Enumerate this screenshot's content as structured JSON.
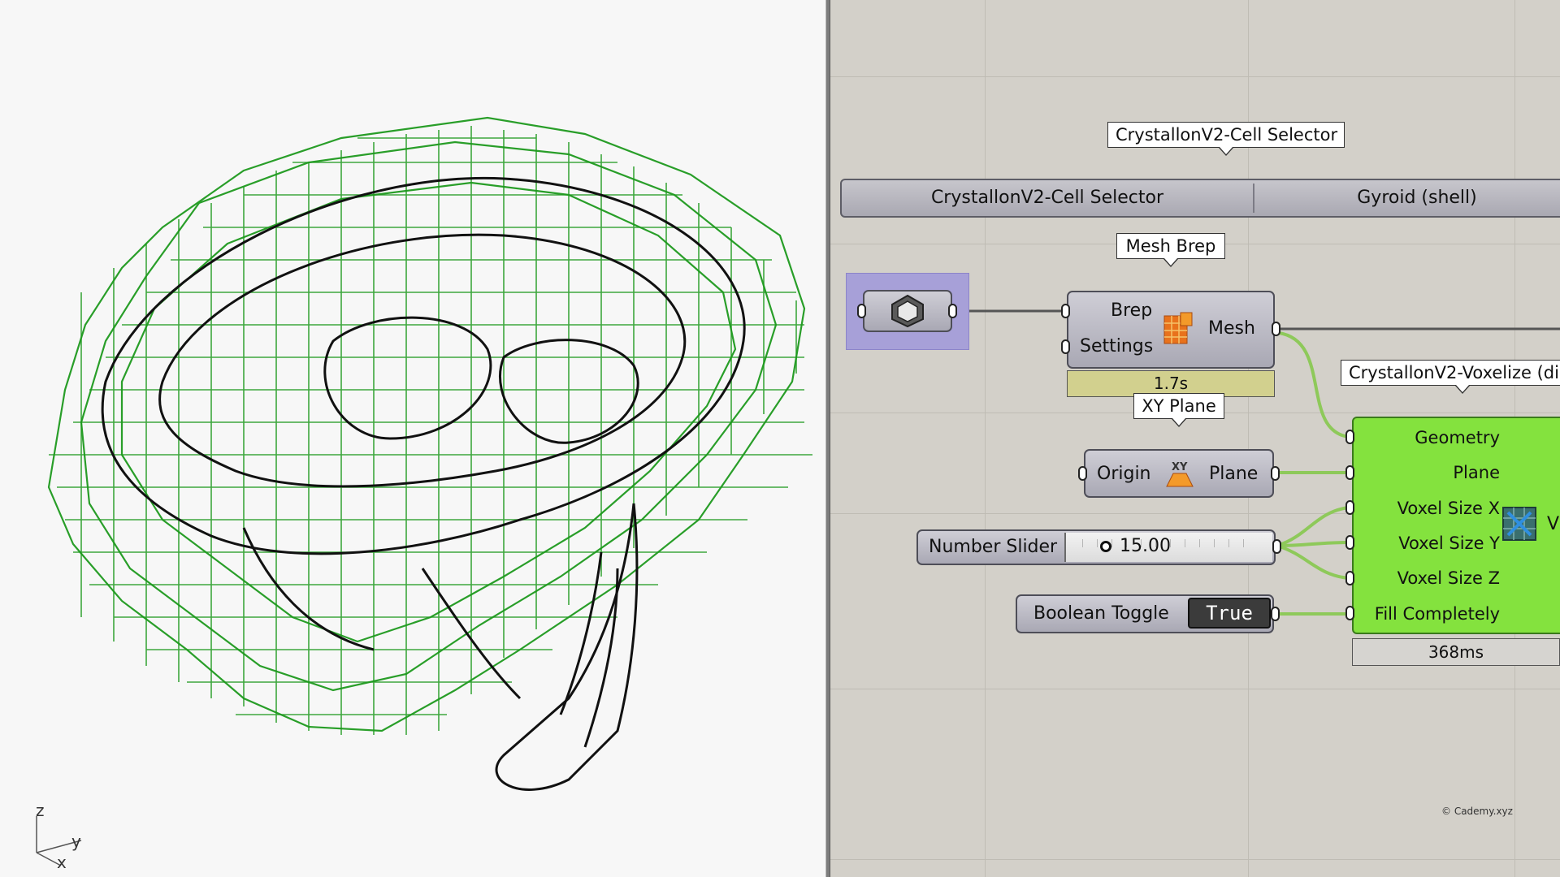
{
  "viewport": {
    "axis_z": "z",
    "axis_y": "y",
    "axis_x": "x"
  },
  "canvas": {
    "cell_selector_tag": "CrystallonV2-Cell Selector",
    "value_list": {
      "label": "CrystallonV2-Cell Selector",
      "selected": "Gyroid (shell)"
    },
    "mesh_brep_tag": "Mesh Brep",
    "mesh_brep": {
      "in_brep": "Brep",
      "in_settings": "Settings",
      "out_mesh": "Mesh",
      "time": "1.7s"
    },
    "xy_plane_tag": "XY Plane",
    "xy_plane": {
      "in_origin": "Origin",
      "out_plane": "Plane"
    },
    "slider": {
      "label": "Number Slider",
      "value": "15.00"
    },
    "toggle": {
      "label": "Boolean Toggle",
      "value": "True"
    },
    "voxelize_tag": "CrystallonV2-Voxelize (di",
    "voxelize": {
      "inputs": [
        "Geometry",
        "Plane",
        "Voxel Size X",
        "Voxel Size Y",
        "Voxel Size Z",
        "Fill Completely"
      ],
      "out_partial": "V",
      "time": "368ms"
    },
    "credit": "© Cademy.xyz",
    "colors": {
      "wire": "#555555",
      "green_wire": "#8ec95a",
      "component_green": "#84e23e",
      "selected": "#a7a0d8",
      "timer": "#d2d08e"
    }
  }
}
